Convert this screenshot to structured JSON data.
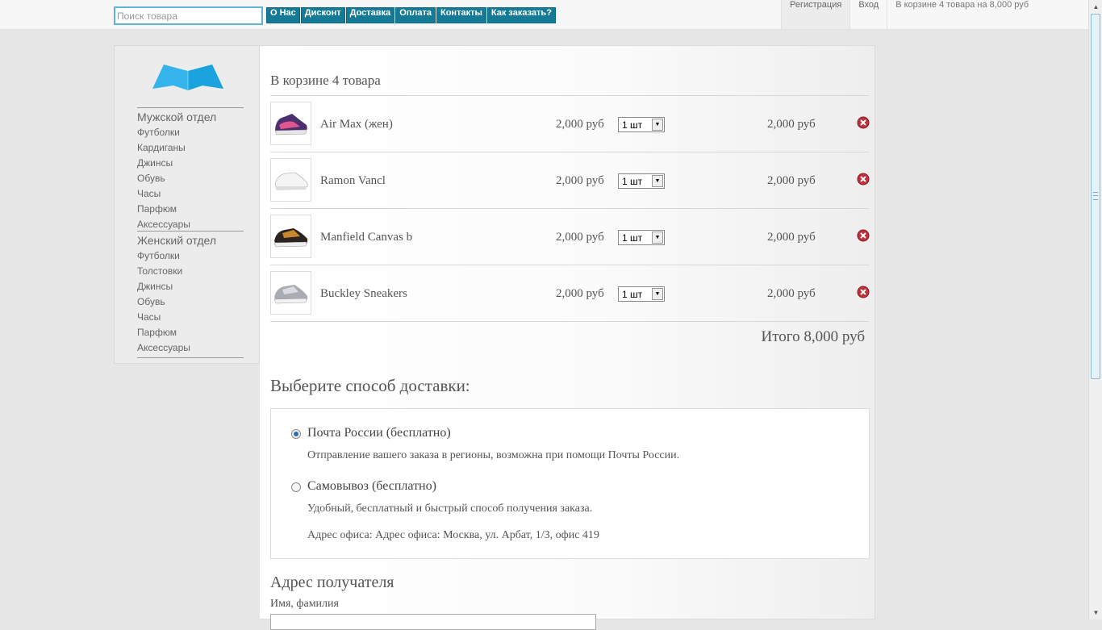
{
  "header": {
    "search_placeholder": "Поиск товара",
    "nav": [
      "О Нас",
      "Дисконт",
      "Доставка",
      "Оплата",
      "Контакты",
      "Как заказать?"
    ],
    "register": "Регистрация",
    "login": "Вход",
    "cart_summary": "В корзине 4 товара на 8,000 руб"
  },
  "sidebar": {
    "men": {
      "title": "Мужской отдел",
      "items": [
        "Футболки",
        "Кардиганы",
        "Джинсы",
        "Обувь",
        "Часы",
        "Парфюм",
        "Аксессуары"
      ]
    },
    "women": {
      "title": "Женский отдел",
      "items": [
        "Футболки",
        "Толстовки",
        "Джинсы",
        "Обувь",
        "Часы",
        "Парфюм",
        "Аксессуары"
      ]
    }
  },
  "cart": {
    "title": "В корзине 4 товара",
    "items": [
      {
        "name": "Air Max (жен)",
        "price": "2,000 руб",
        "qty": "1 шт",
        "total": "2,000 руб"
      },
      {
        "name": "Ramon Vancl",
        "price": "2,000 руб",
        "qty": "1 шт",
        "total": "2,000 руб"
      },
      {
        "name": "Manfield Canvas b",
        "price": "2,000 руб",
        "qty": "1 шт",
        "total": "2,000 руб"
      },
      {
        "name": "Buckley Sneakers",
        "price": "2,000 руб",
        "qty": "1 шт",
        "total": "2,000 руб"
      }
    ],
    "grand_total": "Итого 8,000 руб"
  },
  "delivery": {
    "title": "Выберите способ доставки:",
    "options": [
      {
        "name": "Почта России (бесплатно)",
        "desc": "Отправление вашего заказа в регионы, возможна при помощи Почты России.",
        "selected": true
      },
      {
        "name": "Самовывоз (бесплатно)",
        "desc": "Удобный, бесплатный и быстрый способ получения заказа.",
        "address": "Адрес офиса: Адрес офиса: Москва, ул. Арбат, 1/3, офис 419",
        "selected": false
      }
    ]
  },
  "recipient": {
    "title": "Адрес получателя",
    "name_label": "Имя, фамилия"
  },
  "colors": {
    "accent": "#157a96",
    "search_border": "#5bb6d0",
    "remove": "#c0303a"
  }
}
